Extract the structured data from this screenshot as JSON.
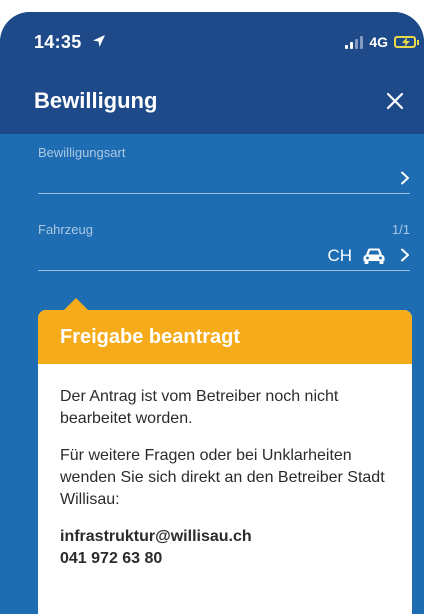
{
  "status_bar": {
    "time": "14:35",
    "network": "4G"
  },
  "header": {
    "title": "Bewilligung"
  },
  "fields": {
    "permit_type": {
      "label": "Bewilligungsart",
      "value": ""
    },
    "vehicle": {
      "label": "Fahrzeug",
      "counter": "1/1",
      "country": "CH"
    }
  },
  "card": {
    "title": "Freigabe beantragt",
    "message": "Der Antrag ist vom Betreiber noch nicht bearbeitet worden.",
    "info": "Für weitere Fragen oder bei Unklarheiten wenden Sie sich direkt an den Betreiber Stadt Willisau:",
    "email": "infrastruktur@willisau.ch",
    "phone": "041 972 63 80"
  },
  "colors": {
    "header_bg": "#1e4a8a",
    "content_bg": "#1e6db3",
    "card_header_bg": "#f6ab1b",
    "battery": "#e7d94a"
  }
}
